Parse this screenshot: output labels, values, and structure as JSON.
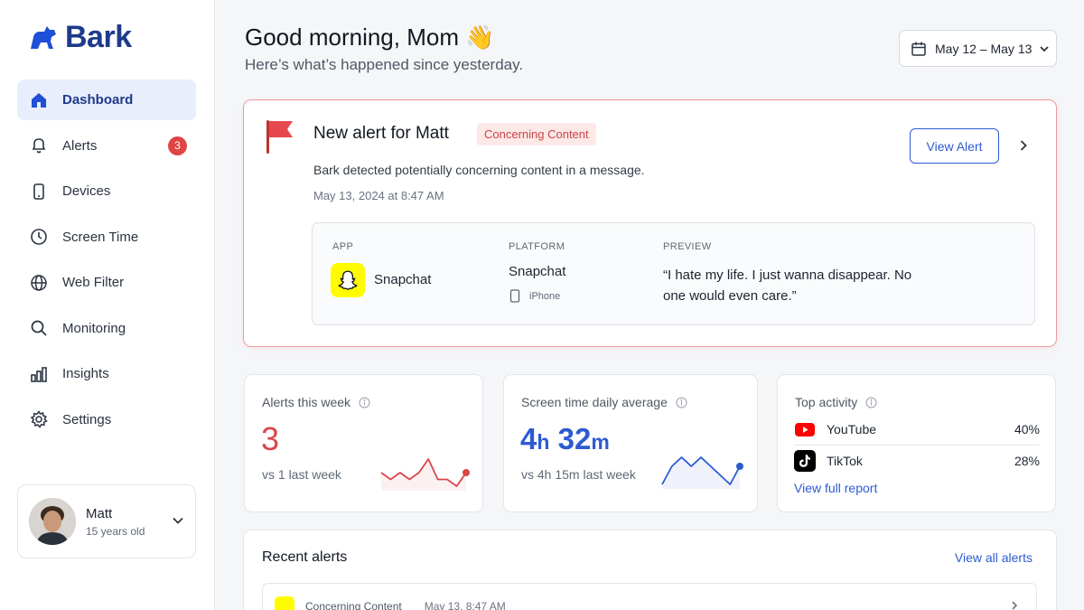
{
  "app": {
    "brand": "Bark"
  },
  "sidebar": {
    "items": [
      {
        "label": "Dashboard",
        "icon": "home-icon",
        "active": true
      },
      {
        "label": "Alerts",
        "icon": "bell-icon",
        "badge": "3"
      },
      {
        "label": "Devices",
        "icon": "phone-icon"
      },
      {
        "label": "Screen Time",
        "icon": "clock-icon"
      },
      {
        "label": "Web Filter",
        "icon": "globe-icon"
      },
      {
        "label": "Monitoring",
        "icon": "search-icon"
      },
      {
        "label": "Insights",
        "icon": "bar-chart-icon"
      },
      {
        "label": "Settings",
        "icon": "gear-icon"
      }
    ],
    "profile": {
      "name": "Matt",
      "age": "15 years old"
    }
  },
  "header": {
    "greeting": "Good morning, Mom 👋",
    "subtitle": "Here’s what’s happened since yesterday.",
    "date_range": "May 12 – May 13"
  },
  "alert": {
    "title": "New alert for Matt",
    "tag": "Concerning Content",
    "description": "Bark detected potentially concerning content in a message.",
    "time": "May 13, 2024 at 8:47 AM",
    "button": "View Alert",
    "headers": {
      "app": "APP",
      "platform": "PLATFORM",
      "preview": "PREVIEW"
    },
    "app": "Snapchat",
    "platform": "Snapchat",
    "device": "iPhone",
    "preview": "“I hate my life. I just wanna disappear. No one would even care.”"
  },
  "stats": {
    "alerts_week": {
      "label": "Alerts this week",
      "value": "3",
      "compare": "vs 1 last week",
      "trend": [
        2,
        1,
        2,
        1,
        2,
        4,
        1,
        1,
        0,
        2
      ]
    },
    "screen_time": {
      "label": "Screen time daily average",
      "hours": "4",
      "hours_unit": "h",
      "minutes": "32",
      "minutes_unit": "m",
      "compare": "vs 4h 15m last week",
      "trend": [
        1,
        3,
        4,
        3,
        4,
        3,
        2,
        1,
        3
      ]
    },
    "top_activity": {
      "label": "Top activity",
      "items": [
        {
          "name": "YouTube",
          "pct": "40%",
          "icon": "youtube-icon"
        },
        {
          "name": "TikTok",
          "pct": "28%",
          "icon": "tiktok-icon"
        }
      ],
      "link": "View full report"
    }
  },
  "recent": {
    "title": "Recent alerts",
    "link": "View all alerts",
    "rows": [
      {
        "type": "Concerning Content",
        "time": "May 13, 8:47 AM"
      }
    ]
  },
  "colors": {
    "brand": "#1e3a8a",
    "accent": "#2d5bd1",
    "alert": "#d9474a",
    "alert_border": "#ef9a9a"
  }
}
